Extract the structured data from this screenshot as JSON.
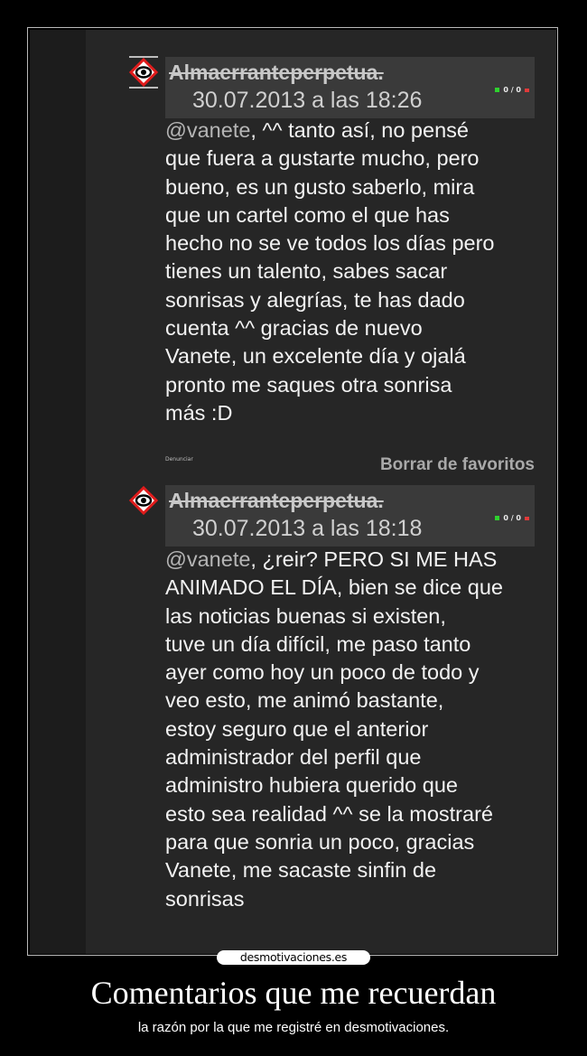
{
  "comments": [
    {
      "username": "Almaerranteperpetua",
      "username_suffix": ".",
      "timestamp": "30.07.2013 a las 18:26",
      "votes": "0 / 0",
      "mention": "@vanete",
      "lines": [
        ", ^^ tanto así, no pensé",
        "que fuera a gustarte mucho, pero",
        "bueno, es un gusto saberlo, mira",
        "que un cartel como el que has",
        "hecho no se ve todos los días pero",
        "tienes un talento, sabes sacar",
        "sonrisas y alegrías, te has dado",
        "cuenta ^^ gracias de nuevo",
        "Vanete, un excelente día y ojalá",
        "pronto me saques otra sonrisa",
        "más :D"
      ],
      "report_label": "Denunciar",
      "unfavorite_label": "Borrar de favoritos"
    },
    {
      "username": "Almaerranteperpetua",
      "username_suffix": ".",
      "timestamp": "30.07.2013 a las 18:18",
      "votes": "0 / 0",
      "mention": "@vanete",
      "lines": [
        ", ¿reir? PERO SI ME HAS",
        "ANIMADO EL DÍA, bien se dice que",
        "las noticias buenas si existen,",
        "tuve un día difícil, me paso tanto",
        "ayer como hoy un poco de todo y",
        "veo esto, me animó bastante,",
        "estoy seguro que el anterior",
        "administrador del perfil que",
        "administro hubiera querido que",
        "esto sea realidad ^^ se la mostraré",
        "para que sonria un poco, gracias",
        "Vanete, me sacaste sinfin de",
        "sonrisas"
      ]
    }
  ],
  "site_logo": "desmotivaciones.es",
  "poster_title": "Comentarios que me recuerdan",
  "poster_subtitle": "la razón por la que me registré en desmotivaciones.",
  "colors": {
    "background": "#000000",
    "panel": "#262626",
    "header": "#3a3a3a",
    "vote_up": "#2fd12f",
    "vote_down": "#e03a3a"
  }
}
